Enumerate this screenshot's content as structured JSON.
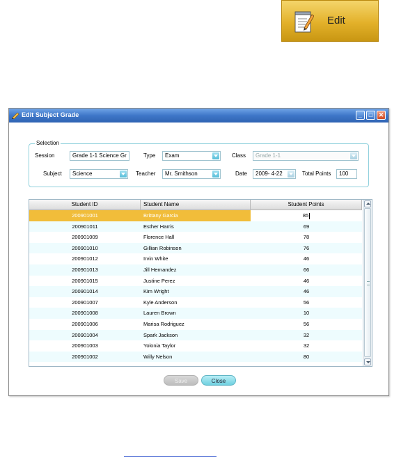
{
  "edit_button": {
    "label": "Edit",
    "icon": "edit-pencil-icon"
  },
  "window": {
    "title": "Edit Subject Grade",
    "controls": {
      "minimize": "_",
      "maximize": "□",
      "close": "✕"
    }
  },
  "selection": {
    "legend": "Selection",
    "session_label": "Session",
    "session_value": "Grade 1-1 Science Gr",
    "type_label": "Type",
    "type_value": "Exam",
    "class_label": "Class",
    "class_value": "Grade 1-1",
    "subject_label": "Subject",
    "subject_value": "Science",
    "teacher_label": "Teacher",
    "teacher_value": "Mr. Smithson",
    "date_label": "Date",
    "date_value": "2009-  4-22",
    "total_points_label": "Total Points",
    "total_points_value": "100"
  },
  "table": {
    "headers": [
      "Student ID",
      "Student Name",
      "Student Points"
    ],
    "rows": [
      {
        "id": "200901001",
        "name": "Brittany Garcia",
        "points": "85"
      },
      {
        "id": "200901011",
        "name": "Esther Harris",
        "points": "69"
      },
      {
        "id": "200901009",
        "name": "Florence Hall",
        "points": "78"
      },
      {
        "id": "200901010",
        "name": "Gillian Robinson",
        "points": "76"
      },
      {
        "id": "200901012",
        "name": "Irvin White",
        "points": "46"
      },
      {
        "id": "200901013",
        "name": "Jill  Hernandez",
        "points": "66"
      },
      {
        "id": "200901015",
        "name": "Justine Perez",
        "points": "46"
      },
      {
        "id": "200901014",
        "name": "Kim Wright",
        "points": "46"
      },
      {
        "id": "200901007",
        "name": "Kyle Anderson",
        "points": "56"
      },
      {
        "id": "200901008",
        "name": "Lauren Brown",
        "points": "10"
      },
      {
        "id": "200901006",
        "name": "Marisa Rodriguez",
        "points": "56"
      },
      {
        "id": "200901004",
        "name": "Spark Jackson",
        "points": "32"
      },
      {
        "id": "200901003",
        "name": "Yolonia Taylor",
        "points": "32"
      },
      {
        "id": "200901002",
        "name": "Willy Nelson",
        "points": "80"
      }
    ]
  },
  "buttons": {
    "save": "Save",
    "close": "Close"
  }
}
